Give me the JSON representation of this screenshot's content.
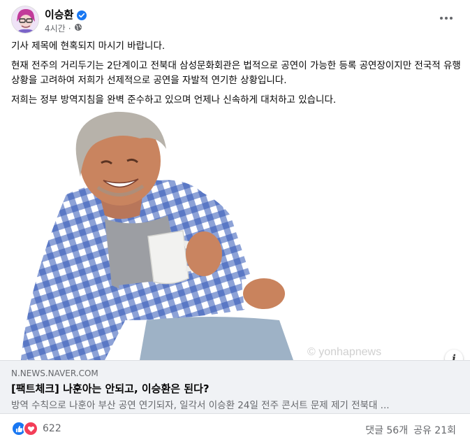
{
  "post": {
    "author": "이승환",
    "time": "4시간",
    "paragraphs": [
      "기사 제목에 현혹되지 마시기 바랍니다.",
      "현재 전주의 거리두기는 2단계이고 전북대 삼성문화회관은 법적으로 공연이 가능한 등록 공연장이지만 전국적 유행 상황을 고려하여 저희가 선제적으로 공연을 자발적 연기한 상황입니다.",
      "저희는 정부 방역지침을 완벽 준수하고 있으며 언제나 신속하게 대처하고 있습니다."
    ]
  },
  "link": {
    "domain": "N.NEWS.NAVER.COM",
    "headline": "[팩트체크] 나훈아는 안되고, 이승환은 된다?",
    "description": "방역 수칙으로 나훈아 부산 공연 연기되자, 일각서 이승환 24일 전주 콘서트 문제 제기 전북대 ..."
  },
  "footer": {
    "reaction_count": "622",
    "comments": "댓글 56개",
    "shares": "공유 21회"
  },
  "colors": {
    "accent": "#1877f2",
    "love": "#f33e58",
    "secondary_text": "#65676b",
    "link_box_bg": "#f0f2f5",
    "shirt_blue": "#2f55b6"
  },
  "icons": [
    "verified-badge-icon",
    "globe-icon",
    "more-options-icon",
    "info-icon",
    "like-reaction-icon",
    "love-reaction-icon"
  ]
}
